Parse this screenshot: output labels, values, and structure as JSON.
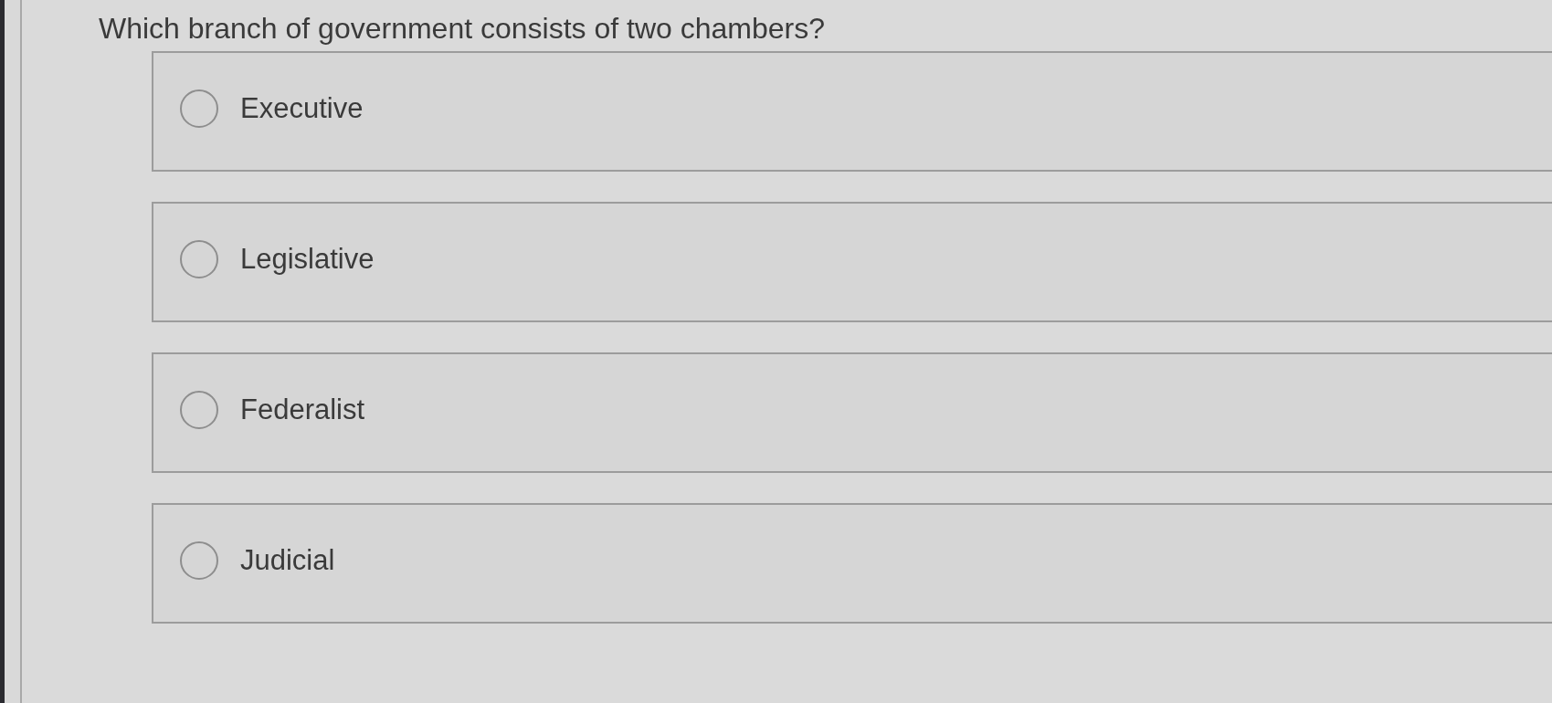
{
  "question": "Which branch of government consists of two chambers?",
  "options": [
    {
      "label": "Executive",
      "selected": false
    },
    {
      "label": "Legislative",
      "selected": false
    },
    {
      "label": "Federalist",
      "selected": false
    },
    {
      "label": "Judicial",
      "selected": false
    }
  ]
}
